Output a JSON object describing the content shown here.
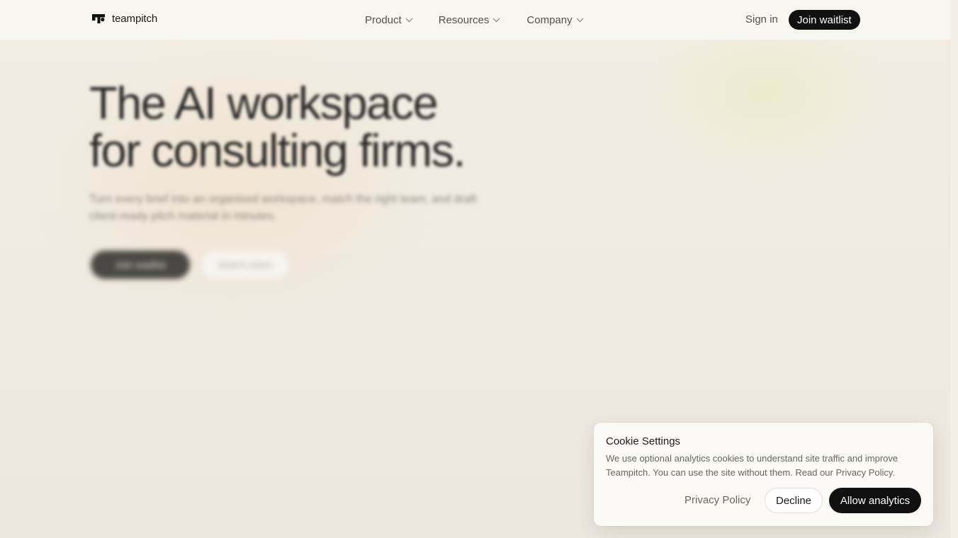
{
  "header": {
    "brand_name": "teampitch",
    "logo_icon": "teampitch-logo-icon",
    "nav": [
      {
        "label": "Product",
        "icon": "chevron-down-icon"
      },
      {
        "label": "Resources",
        "icon": "chevron-down-icon"
      },
      {
        "label": "Company",
        "icon": "chevron-down-icon"
      }
    ],
    "sign_in": "Sign in",
    "join_waitlist": "Join waitlist"
  },
  "hero": {
    "title_line1": "The AI workspace",
    "title_line2": "for consulting firms.",
    "subtitle": "Turn every brief into an organised workspace, match the right team, and draft client-ready pitch material in minutes.",
    "primary_cta": "Join waitlist",
    "secondary_cta": "Watch video"
  },
  "cookie": {
    "title": "Cookie Settings",
    "text": "We use optional analytics cookies to understand site traffic and improve Teampitch. You can use the site without them. Read our Privacy Policy.",
    "privacy_link": "Privacy Policy",
    "decline": "Decline",
    "allow": "Allow analytics"
  },
  "colors": {
    "page_bg": "#efebe2",
    "button_dark": "#111111",
    "text_muted": "#6a655e"
  }
}
